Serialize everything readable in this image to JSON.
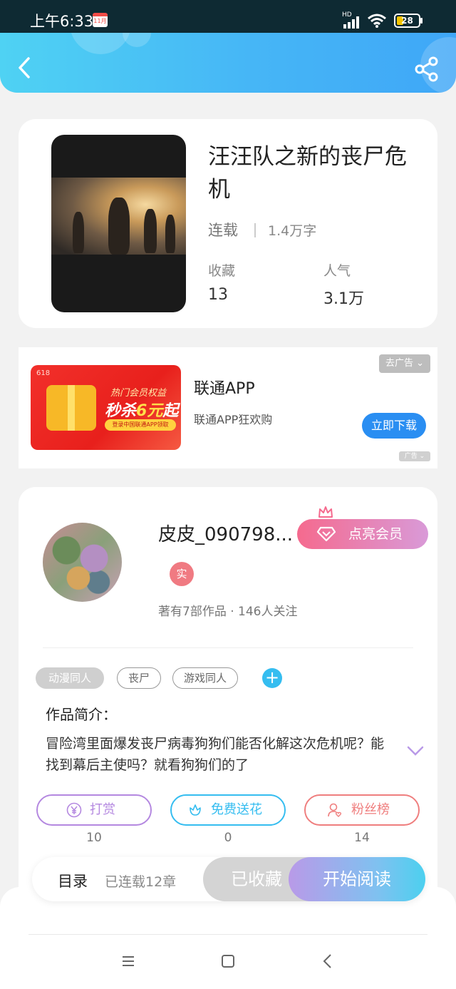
{
  "status_bar": {
    "time": "上午6:33",
    "calendar_day": "11月",
    "network": "HD",
    "battery": "28"
  },
  "book": {
    "title": "汪汪队之新的丧尸危机",
    "status": "连载",
    "word_count": "1.4万字",
    "stats": [
      {
        "label": "收藏",
        "value": "13"
      },
      {
        "label": "人气",
        "value": "3.1万"
      }
    ]
  },
  "ad": {
    "close_label": "去广告",
    "title": "联通APP",
    "description": "联通APP狂欢购",
    "download_label": "立即下载",
    "ad_mark": "广告",
    "banner_logo": "618",
    "banner_line1": "热门会员权益",
    "banner_line2_prefix": "秒杀",
    "banner_line2_highlight": "6元",
    "banner_line2_suffix": "起",
    "banner_pill": "登录中国联通APP领取"
  },
  "author": {
    "name": "皮皮_090798...",
    "vip_label": "点亮会员",
    "real_badge": "实",
    "stats_text": "著有7部作品 · 146人关注"
  },
  "tags": [
    "动漫同人",
    "丧尸",
    "游戏同人"
  ],
  "intro": {
    "heading": "作品简介：",
    "text": "冒险湾里面爆发丧尸病毒狗狗们能否化解这次危机呢？能找到幕后主使吗？就看狗狗们的了"
  },
  "actions": [
    {
      "label": "打赏",
      "count": "10",
      "icon": "yen-icon",
      "color": "#b488e0"
    },
    {
      "label": "免费送花",
      "count": "0",
      "icon": "flower-icon",
      "color": "#35bdf0"
    },
    {
      "label": "粉丝榜",
      "count": "14",
      "icon": "fan-icon",
      "color": "#ef7e7e"
    }
  ],
  "reading_bar": {
    "toc_label": "目录",
    "chapter_count": "已连载12章",
    "collected_label": "已收藏",
    "read_label": "开始阅读"
  }
}
